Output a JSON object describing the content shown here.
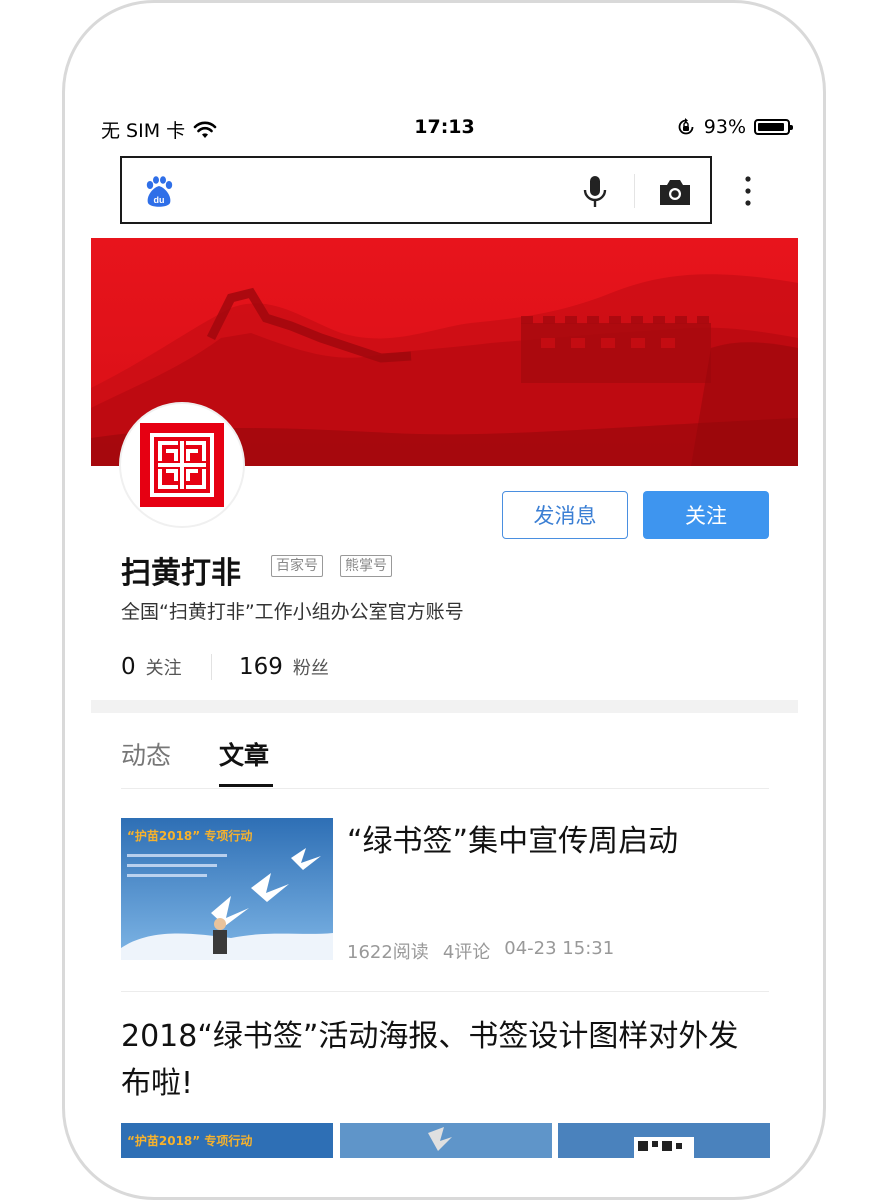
{
  "statusbar": {
    "carrier": "无 SIM 卡",
    "time": "17:13",
    "battery_percent": "93%",
    "battery_level": 0.93
  },
  "search": {
    "value": "",
    "placeholder": ""
  },
  "profile": {
    "name": "扫黄打非",
    "tags": [
      "百家号",
      "熊掌号"
    ],
    "description": "全国“扫黄打非”工作小组办公室官方账号",
    "following_count": "0",
    "following_label": "关注",
    "fans_count": "169",
    "fans_label": "粉丝",
    "message_button": "发消息",
    "follow_button": "关注"
  },
  "tabs": [
    {
      "label": "动态",
      "active": false
    },
    {
      "label": "文章",
      "active": true
    }
  ],
  "articles": [
    {
      "title": "“绿书签”集中宣传周启动",
      "reads": "1622阅读",
      "comments": "4评论",
      "date": "04-23 15:31"
    },
    {
      "title": "2018“绿书签”活动海报、书签设计图样对外发布啦!"
    }
  ],
  "thumbnail_text": "“护苗2018” 专项行动",
  "colors": {
    "accent_blue": "#3e95ef",
    "banner_red": "#e0141c",
    "seal_red": "#e60012"
  }
}
